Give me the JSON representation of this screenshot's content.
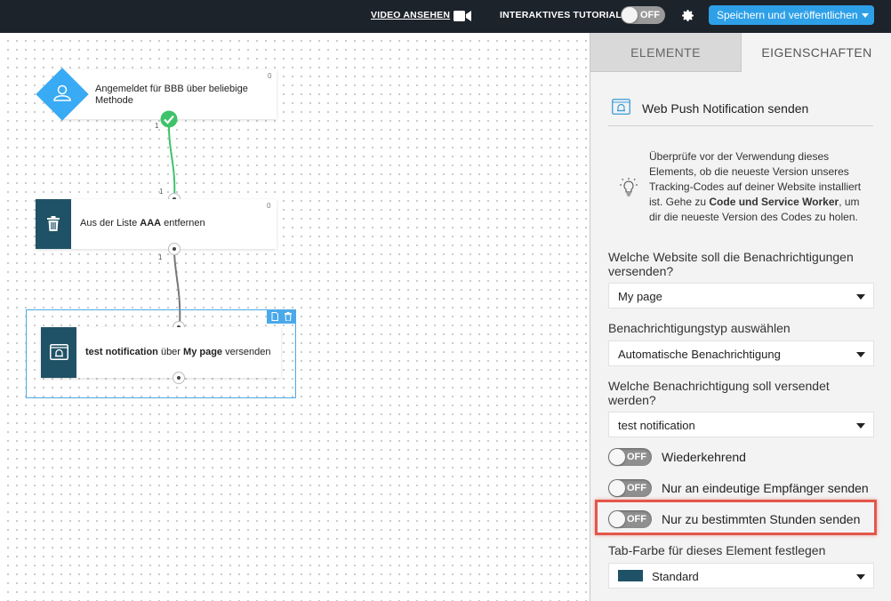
{
  "topbar": {
    "video_label": "VIDEO ANSEHEN",
    "video_icon": "camera-icon",
    "tutorial_label": "INTERAKTIVES TUTORIAL",
    "tutorial_toggle": "OFF",
    "settings_icon": "gear-icon",
    "publish_label": "Speichern und veröffentlichen"
  },
  "canvas": {
    "nodes": [
      {
        "type": "trigger",
        "icon": "user-icon",
        "text": "Angemeldet für BBB über beliebige Methode",
        "count": "0",
        "status_icon": "check-circle-icon"
      },
      {
        "type": "action",
        "icon": "trash-icon",
        "text_pre": "Aus der Liste ",
        "text_bold": "AAA",
        "text_post": " entfernen",
        "count": "0"
      },
      {
        "type": "action",
        "icon": "web-push-icon",
        "text_bold1": "test notification",
        "text_mid": " über ",
        "text_bold2": "My page",
        "text_post": " versenden",
        "tools": [
          "copy-icon",
          "trash-icon"
        ]
      }
    ],
    "edges": [
      {
        "out_label": "1",
        "in_label": "1",
        "color": "#3fc26a"
      },
      {
        "out_label": "1",
        "color": "#777777"
      }
    ]
  },
  "panel": {
    "tabs": [
      "ELEMENTE",
      "EIGENSCHAFTEN"
    ],
    "active_tab": "EIGENSCHAFTEN",
    "title": "Web Push Notification senden",
    "info": {
      "text_pre": "Überprüfe vor der Verwendung dieses Elements, ob die neueste Version unseres Tracking-Codes auf deiner Website installiert ist. Gehe zu ",
      "text_bold": "Code und Service Worker",
      "text_post": ", um dir die neueste Version des Codes zu holen."
    },
    "website_label": "Welche Website soll die Benachrichtigungen versenden?",
    "website_value": "My page",
    "type_label": "Benachrichtigungstyp auswählen",
    "type_value": "Automatische Benachrichtigung",
    "notification_label": "Welche Benachrichtigung soll versendet werden?",
    "notification_value": "test notification",
    "toggles": [
      {
        "label": "Wiederkehrend",
        "state": "OFF"
      },
      {
        "label": "Nur an eindeutige Empfänger senden",
        "state": "OFF"
      },
      {
        "label": "Nur zu bestimmten Stunden senden",
        "state": "OFF",
        "highlighted": true
      }
    ],
    "tab_color_label": "Tab-Farbe für dieses Element festlegen",
    "tab_color_value": "Standard",
    "tab_color_swatch": "#1f5266"
  },
  "colors": {
    "topbar": "#1d232b",
    "accent": "#2ea0e8",
    "node_icon_bg": "#1f5266",
    "trigger_diamond": "#39aaf4",
    "success": "#3fc26a",
    "highlight": "#e4564b"
  }
}
